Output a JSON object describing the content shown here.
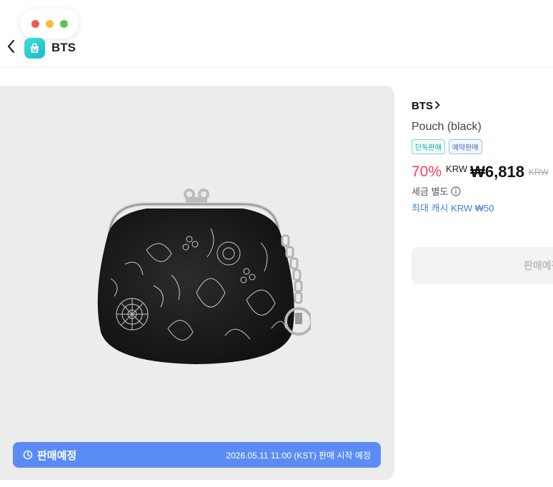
{
  "window": {
    "controls": [
      "#ee5b54",
      "#f5be3a",
      "#5fc453"
    ]
  },
  "header": {
    "back_icon": "chevron-left-icon",
    "app_logo": "shopping-bag-icon",
    "title": "BTS"
  },
  "colors": {
    "sale_bar": "#5b8cf5",
    "discount": "#ef4358",
    "cash": "#3f7fe0",
    "exclusive_badge": "#15a6a0",
    "preorder_badge": "#3f6ec4"
  },
  "product": {
    "brand": "BTS",
    "name": "Pouch (black)",
    "badges": [
      "단독판매",
      "예약판매"
    ],
    "discount": "70%",
    "currency": "KRW",
    "price": "₩6,818",
    "original_price": "KRW",
    "tax_note": "세금 별도",
    "max_cash": "최대 캐시 KRW ₩50",
    "image": "black floral print clasp pouch with metal chain key ring"
  },
  "sale_bar": {
    "status": "판매예정",
    "start": "2026.05.11 11:00 (KST) 판매 시작 예정"
  },
  "buy_button": {
    "label": "판매예정"
  }
}
